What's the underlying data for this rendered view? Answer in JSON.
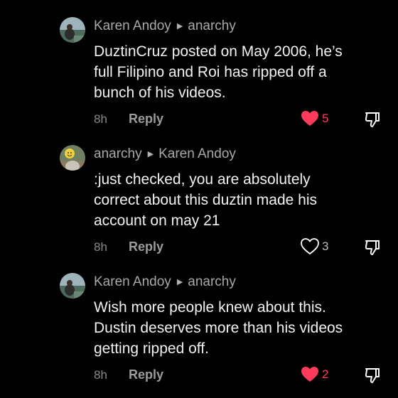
{
  "colors": {
    "background": "#000000",
    "liked": "#ff3b5c",
    "muted": "#9c9c9c"
  },
  "comments": [
    {
      "author": "Karen Andoy",
      "reply_to": "anarchy",
      "text_lines": [
        "DuztinCruz posted on May 2006, he’s",
        "full Filipino and Roi has ripped off a",
        "bunch of his videos."
      ],
      "time": "8h",
      "reply_label": "Reply",
      "likes": "5",
      "liked": true,
      "avatar_icon": "avatar-icon"
    },
    {
      "author": "anarchy",
      "reply_to": "Karen Andoy",
      "text_lines": [
        ":just checked, you are absolutely",
        "correct about this duztin made his",
        "account on may 21"
      ],
      "time": "8h",
      "reply_label": "Reply",
      "likes": "3",
      "liked": false,
      "avatar_icon": "avatar-icon"
    },
    {
      "author": "Karen Andoy",
      "reply_to": "anarchy",
      "text_lines": [
        "Wish more people knew about this.",
        "Dustin deserves more than his videos",
        "getting ripped off."
      ],
      "time": "8h",
      "reply_label": "Reply",
      "likes": "2",
      "liked": true,
      "avatar_icon": "avatar-icon"
    }
  ]
}
